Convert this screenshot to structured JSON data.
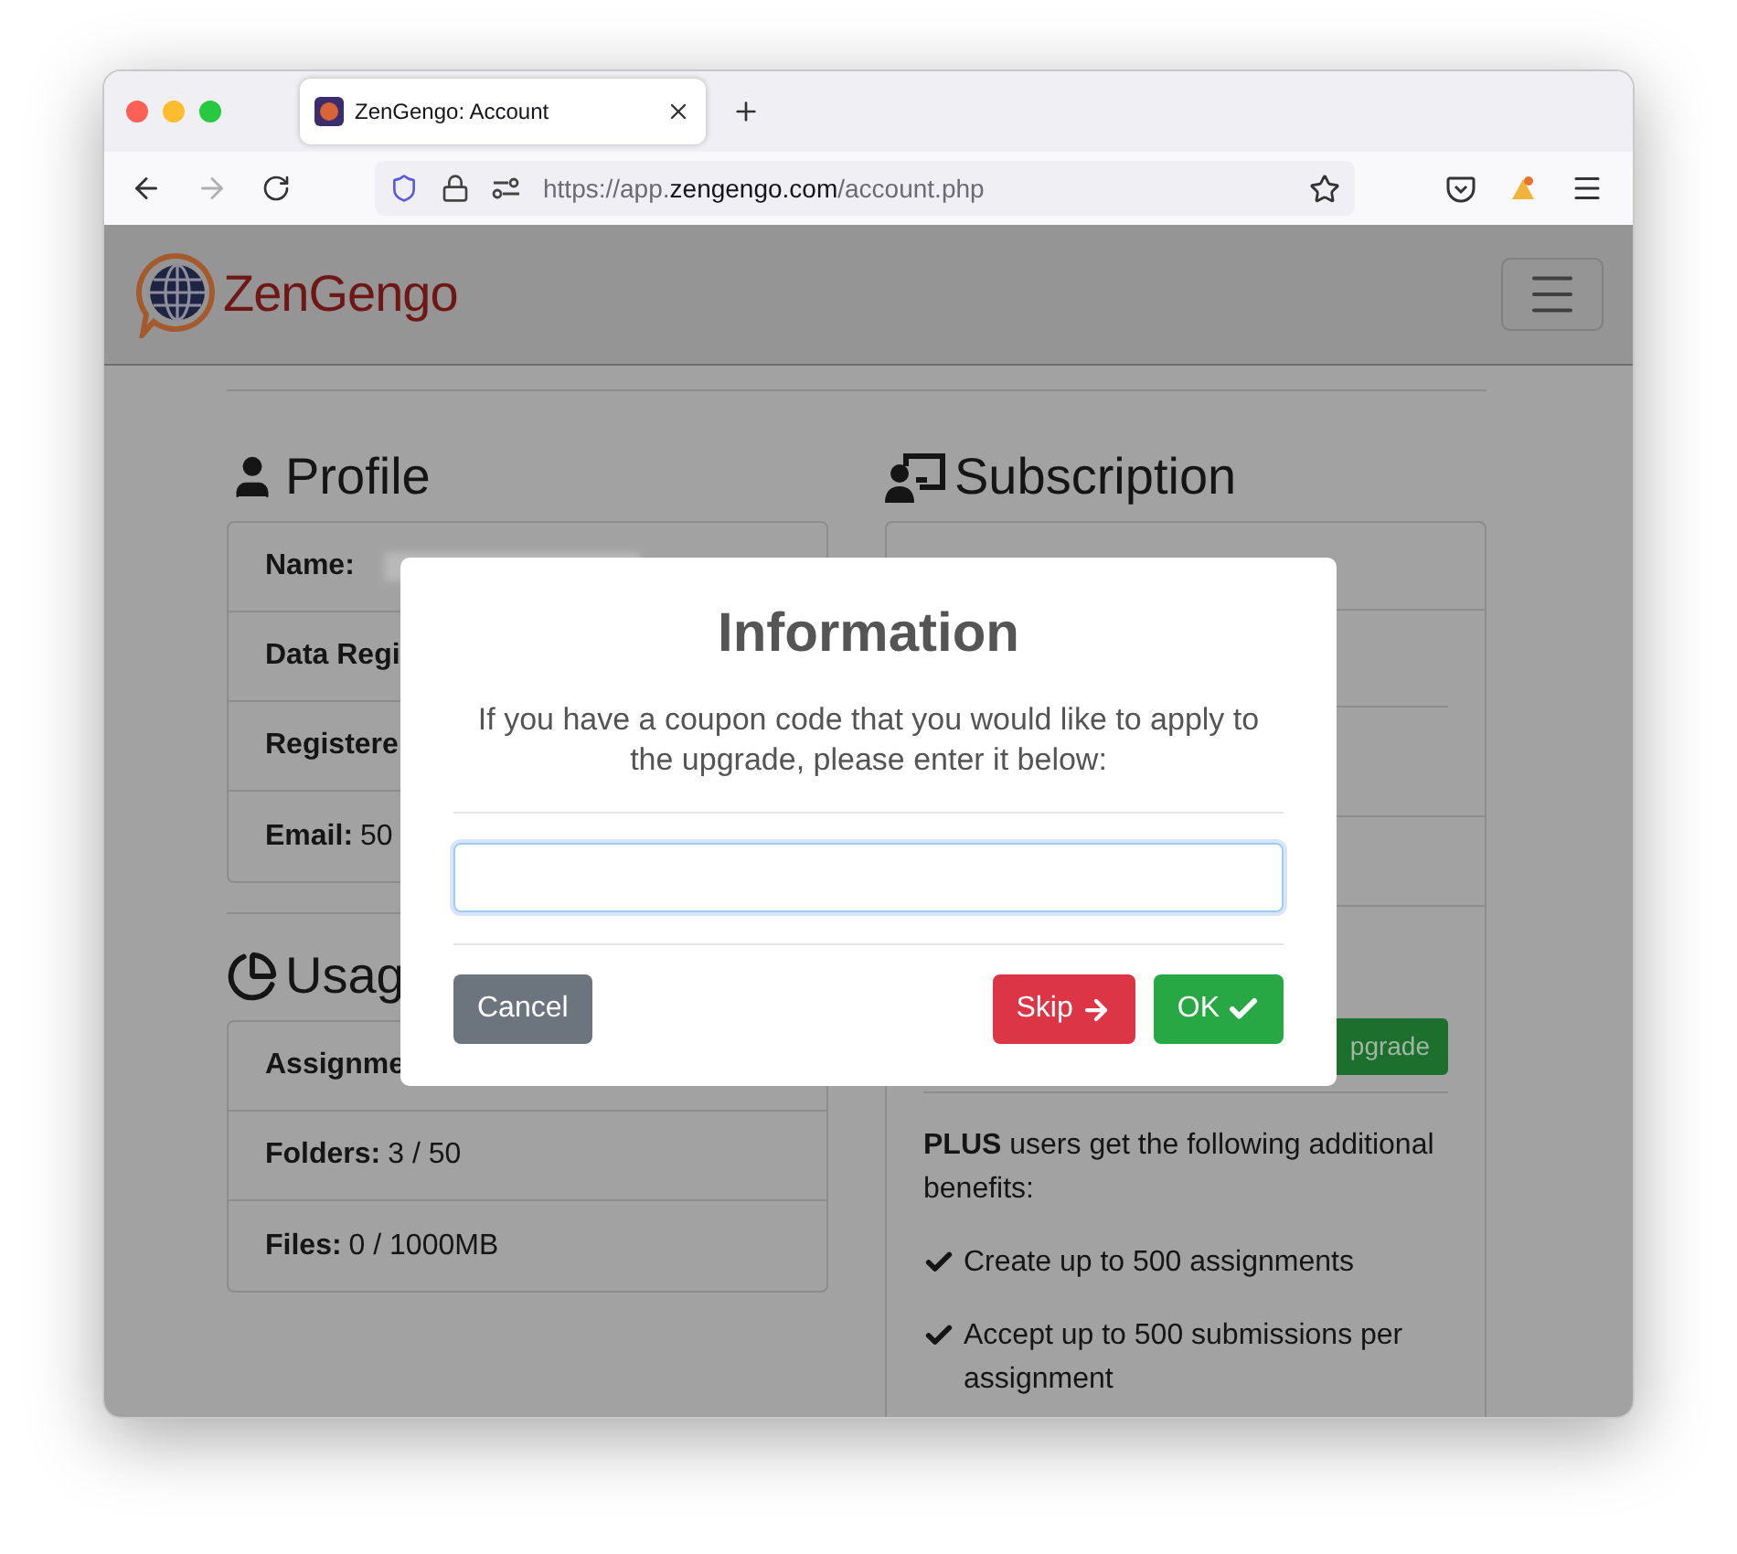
{
  "browser": {
    "tab_title": "ZenGengo: Account",
    "url": [
      {
        "text": "https://app.",
        "kind": "dim"
      },
      {
        "text": "zengengo.com",
        "kind": "strong"
      },
      {
        "text": "/account.php",
        "kind": "dim"
      }
    ]
  },
  "navbar": {
    "brand": "ZenGengo"
  },
  "profile": {
    "title": "Profile",
    "rows": [
      {
        "label": "Name:",
        "kind": "redacted"
      },
      {
        "label": "Data Regi",
        "kind": "plain"
      },
      {
        "label": "Registere",
        "kind": "plain"
      },
      {
        "label": "Email:",
        "value": "50",
        "kind": "plain"
      }
    ]
  },
  "usage": {
    "title": "Usag",
    "rows": [
      {
        "label": "Assignme",
        "kind": "plain"
      },
      {
        "label": "Folders:",
        "value": "3 / 50",
        "kind": "plain"
      },
      {
        "label": "Files:",
        "value": "0 / 1000MB",
        "kind": "plain"
      }
    ]
  },
  "subscription": {
    "title": "Subscription",
    "upgrade_button": "pgrade",
    "benefits_intro": "**PLUS** users get the following additional benefits:",
    "benefits": [
      "Create up to 500 assignments",
      "Accept up to 500 submissions per assignment"
    ]
  },
  "dialog": {
    "title": "Information",
    "message": "If you have a coupon code that you would like to apply to the upgrade, please enter it below:",
    "buttons": [
      {
        "label": "Cancel",
        "kind": "secondary"
      },
      {
        "label": "Skip",
        "kind": "danger"
      },
      {
        "label": "OK",
        "kind": "success"
      }
    ]
  }
}
